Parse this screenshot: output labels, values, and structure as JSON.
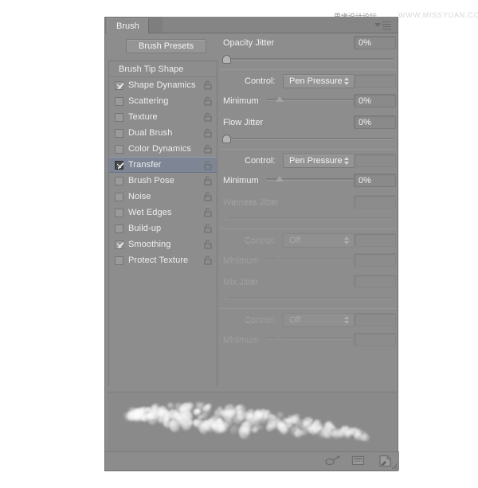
{
  "watermark": {
    "cn_text": "思缘设计论坛",
    "en_text": "WWW.MISSYUAN.COM"
  },
  "panel": {
    "tab_label": "Brush",
    "menu_icon": "panel-menu-icon",
    "presets_button_label": "Brush Presets",
    "bottom_caption": ""
  },
  "option_list": {
    "header_label": "Brush Tip Shape",
    "items": [
      {
        "label": "Shape Dynamics",
        "checked": true,
        "selected": false,
        "lock": "unlocked-icon"
      },
      {
        "label": "Scattering",
        "checked": false,
        "selected": false,
        "lock": "unlocked-icon"
      },
      {
        "label": "Texture",
        "checked": false,
        "selected": false,
        "lock": "unlocked-icon"
      },
      {
        "label": "Dual Brush",
        "checked": false,
        "selected": false,
        "lock": "unlocked-icon"
      },
      {
        "label": "Color Dynamics",
        "checked": false,
        "selected": false,
        "lock": "unlocked-icon"
      },
      {
        "label": "Transfer",
        "checked": true,
        "selected": true,
        "lock": "unlocked-icon"
      },
      {
        "label": "Brush Pose",
        "checked": false,
        "selected": false,
        "lock": "unlocked-icon"
      },
      {
        "label": "Noise",
        "checked": false,
        "selected": false,
        "lock": "unlocked-icon"
      },
      {
        "label": "Wet Edges",
        "checked": false,
        "selected": false,
        "lock": "unlocked-icon"
      },
      {
        "label": "Build-up",
        "checked": false,
        "selected": false,
        "lock": "unlocked-icon"
      },
      {
        "label": "Smoothing",
        "checked": true,
        "selected": false,
        "lock": "unlocked-icon"
      },
      {
        "label": "Protect Texture",
        "checked": false,
        "selected": false,
        "lock": "unlocked-icon"
      }
    ]
  },
  "sections": [
    {
      "title": "Opacity Jitter",
      "value": "0%",
      "slider_percent": 0,
      "control_label": "Control:",
      "control_value": "Pen Pressure",
      "minimum_label": "Minimum",
      "minimum_value": "0%",
      "minimum_percent": 8,
      "enabled": true
    },
    {
      "title": "Flow Jitter",
      "value": "0%",
      "slider_percent": 0,
      "control_label": "Control:",
      "control_value": "Pen Pressure",
      "minimum_label": "Minimum",
      "minimum_value": "0%",
      "minimum_percent": 8,
      "enabled": true
    },
    {
      "title": "Wetness Jitter",
      "value": "",
      "slider_percent": 0,
      "control_label": "Control:",
      "control_value": "Off",
      "minimum_label": "Minimum",
      "minimum_value": "",
      "minimum_percent": 8,
      "enabled": false
    },
    {
      "title": "Mix Jitter",
      "value": "",
      "slider_percent": 0,
      "control_label": "Control:",
      "control_value": "Off",
      "minimum_label": "Minimum",
      "minimum_value": "",
      "minimum_percent": 8,
      "enabled": false
    }
  ],
  "preview": {
    "name": "brush-stroke-preview"
  },
  "bottom_bar": {
    "icons": [
      {
        "name": "toggle-airbrush-icon"
      },
      {
        "name": "new-brush-preset-icon"
      },
      {
        "name": "create-new-brush-icon"
      }
    ]
  },
  "colors": {
    "panel_bg": "#8d8d8d",
    "selected_row": "#7e8696",
    "text": "#f0f0f0",
    "text_disabled": "#9a9a9a",
    "field_bg": "#8a8a8a",
    "border": "#7a7a7a"
  }
}
